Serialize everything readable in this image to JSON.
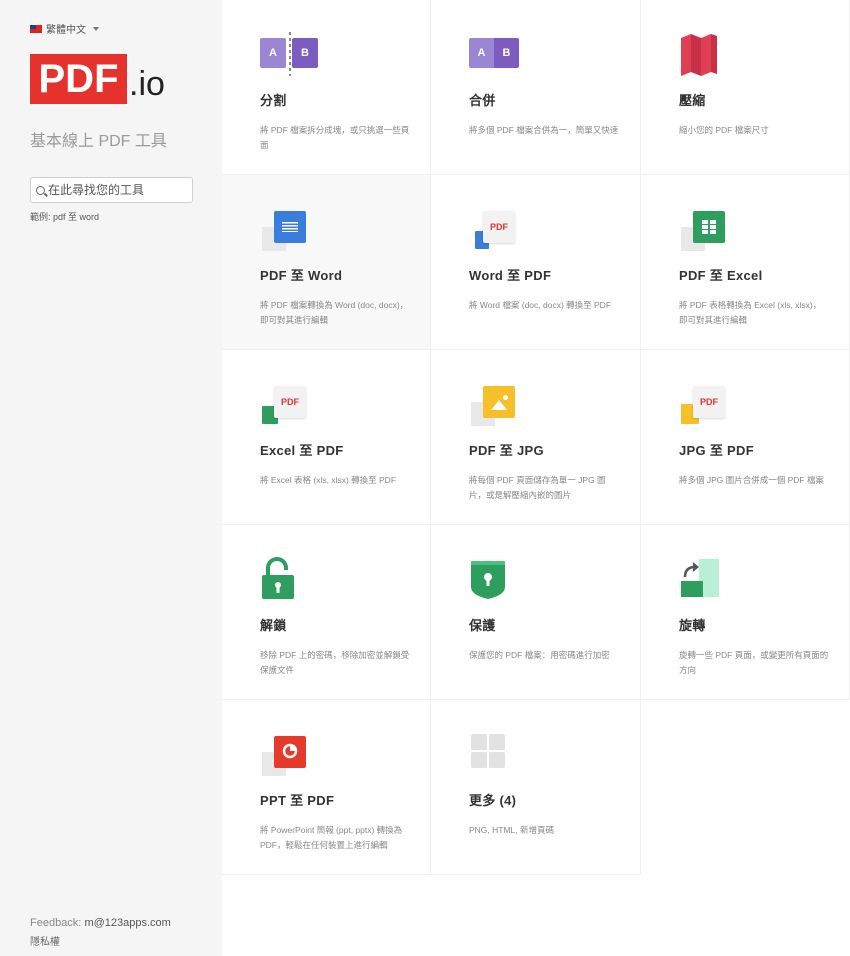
{
  "sidebar": {
    "language": "繁體中文",
    "logo_brand": "PDF",
    "logo_suffix": ".io",
    "tagline": "基本線上 PDF 工具",
    "search_placeholder": "在此尋找您的工具",
    "example": "範例: pdf 至 word",
    "feedback_label": "Feedback:",
    "feedback_email": "m@123apps.com",
    "privacy": "隱私權"
  },
  "colors": {
    "brand_red": "#e5322d",
    "purple": "#7c5cbf",
    "purple_light": "#9b86d4",
    "blue": "#3b7ddd",
    "green": "#2e9e5e",
    "yellow": "#f6c02a",
    "pink_red": "#e04053",
    "orange_red": "#e53b2a"
  },
  "tools": [
    {
      "title": "分割",
      "desc": "將 PDF 檔案拆分成塊，或只挑選一些頁面",
      "icon": "split-icon"
    },
    {
      "title": "合併",
      "desc": "將多個 PDF 檔案合併為一，簡單又快速",
      "icon": "merge-icon"
    },
    {
      "title": "壓縮",
      "desc": "縮小您的 PDF 檔案尺寸",
      "icon": "compress-icon"
    },
    {
      "title": "PDF 至 Word",
      "desc": "將 PDF 檔案轉換為 Word (doc, docx)，即可對其進行編輯",
      "icon": "pdf-to-word-icon"
    },
    {
      "title": "Word 至 PDF",
      "desc": "將 Word 檔案 (doc, docx) 轉換至 PDF",
      "icon": "word-to-pdf-icon"
    },
    {
      "title": "PDF 至 Excel",
      "desc": "將 PDF 表格轉換為 Excel (xls, xlsx)，即可對其進行編輯",
      "icon": "pdf-to-excel-icon"
    },
    {
      "title": "Excel 至 PDF",
      "desc": "將 Excel 表格 (xls, xlsx) 轉換至 PDF",
      "icon": "excel-to-pdf-icon"
    },
    {
      "title": "PDF 至 JPG",
      "desc": "將每個 PDF 頁面儲存為單一 JPG 圖片，或是解壓縮內嵌的圖片",
      "icon": "pdf-to-jpg-icon"
    },
    {
      "title": "JPG 至 PDF",
      "desc": "將多個 JPG 圖片合併成一個 PDF 檔案",
      "icon": "jpg-to-pdf-icon"
    },
    {
      "title": "解鎖",
      "desc": "移除 PDF 上的密碼，移除加密並解鎖受保護文件",
      "icon": "unlock-icon"
    },
    {
      "title": "保護",
      "desc": "保護您的 PDF 檔案：用密碼進行加密",
      "icon": "protect-icon"
    },
    {
      "title": "旋轉",
      "desc": "旋轉一些 PDF 頁面，或變更所有頁面的方向",
      "icon": "rotate-icon"
    },
    {
      "title": "PPT 至 PDF",
      "desc": "將 PowerPoint 簡報 (ppt, pptx) 轉換為 PDF，輕鬆在任何裝置上進行編輯",
      "icon": "ppt-to-pdf-icon"
    },
    {
      "title": "更多 (4)",
      "desc": "PNG, HTML, 新增頁碼",
      "icon": "more-icon"
    }
  ],
  "icon_text": {
    "split_a": "A",
    "split_b": "B",
    "merge_a": "A",
    "merge_b": "B",
    "pdf": "PDF"
  }
}
